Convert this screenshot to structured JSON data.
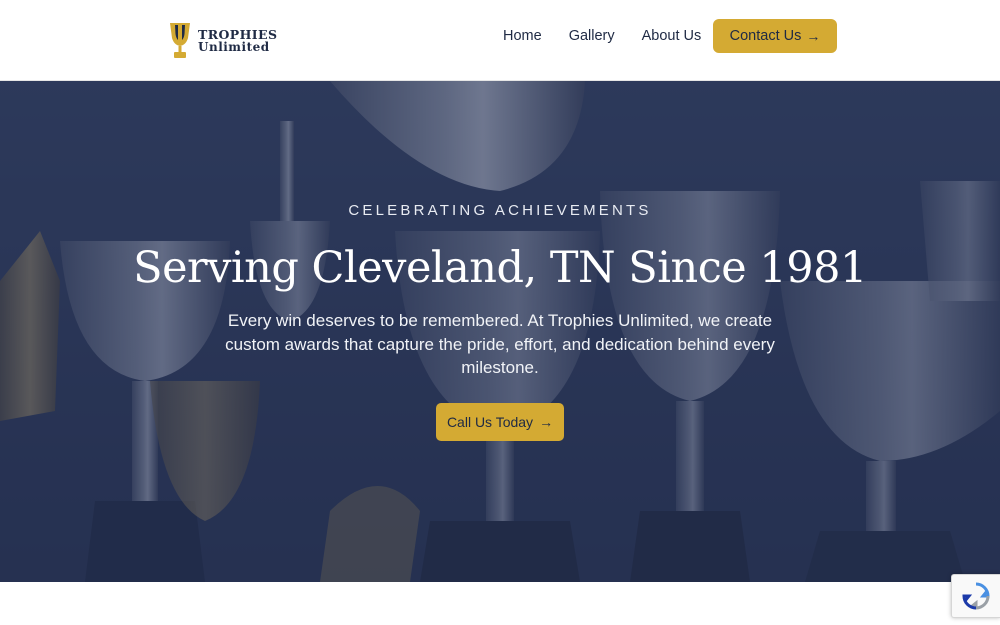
{
  "header": {
    "logo": {
      "line1": "TROPHIES",
      "line2": "Unlimited"
    },
    "nav": [
      {
        "label": "Home"
      },
      {
        "label": "Gallery"
      },
      {
        "label": "About Us"
      }
    ],
    "contact_button": {
      "label": "Contact Us",
      "arrow": "→"
    }
  },
  "hero": {
    "eyebrow": "CELEBRATING ACHIEVEMENTS",
    "headline": "Serving Cleveland, TN Since 1981",
    "subtext": "Every win deserves to be remembered. At Trophies Unlimited, we create custom awards that capture the pride, effort, and dedication behind every milestone.",
    "cta": {
      "label": "Call Us Today",
      "arrow": "→"
    }
  },
  "colors": {
    "accent": "#d4aa33",
    "navy": "#1f2a44",
    "hero_overlay": "#233052"
  },
  "icons": {
    "logo": "trophy-icon",
    "badge": "recaptcha-icon"
  }
}
